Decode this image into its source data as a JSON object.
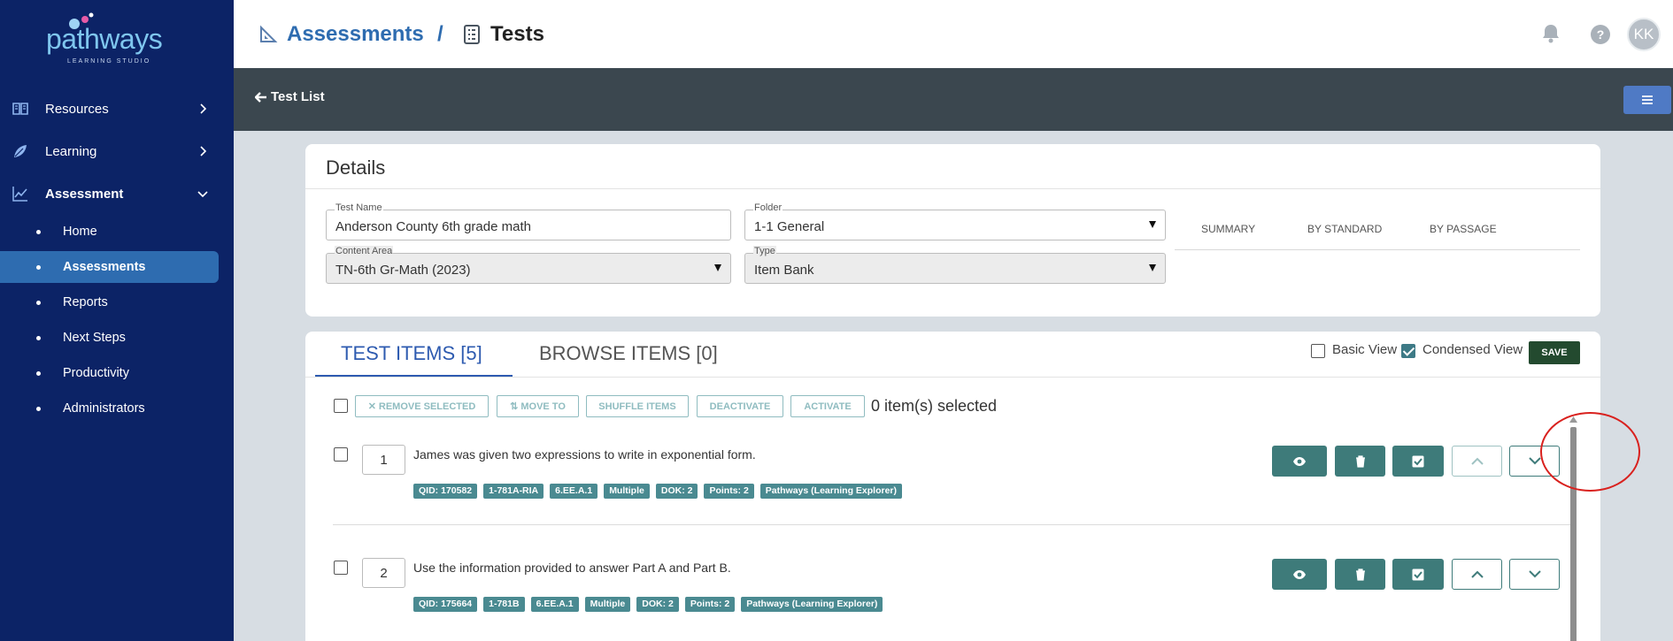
{
  "brand": {
    "name": "pathways",
    "tagline": "LEARNING STUDIO"
  },
  "colors": {
    "sidebar": "#0c2366",
    "active_nav": "#2e6cb0",
    "teal": "#3e7b7a",
    "save": "#234a2f",
    "highlight": "#d9211e"
  },
  "sidebar": {
    "items": [
      {
        "label": "Resources",
        "icon": "book-icon"
      },
      {
        "label": "Learning",
        "icon": "leaf-icon"
      },
      {
        "label": "Assessment",
        "icon": "chart-icon"
      }
    ],
    "subitems": [
      {
        "label": "Home"
      },
      {
        "label": "Assessments"
      },
      {
        "label": "Reports"
      },
      {
        "label": "Next Steps"
      },
      {
        "label": "Productivity"
      },
      {
        "label": "Administrators"
      }
    ]
  },
  "header": {
    "crumb1": "Assessments",
    "separator": "/",
    "crumb2": "Tests",
    "avatar": "KK",
    "help": "?"
  },
  "toolbar": {
    "back_label": "Test List"
  },
  "details": {
    "title": "Details",
    "test_name_label": "Test Name",
    "test_name": "Anderson County 6th grade math",
    "folder_label": "Folder",
    "folder": "1-1 General",
    "content_area_label": "Content Area",
    "content_area": "TN-6th Gr-Math (2023)",
    "type_label": "Type",
    "type": "Item Bank",
    "tabs": [
      "SUMMARY",
      "BY STANDARD",
      "BY PASSAGE"
    ]
  },
  "items_panel": {
    "tab_test_items": "TEST ITEMS [5]",
    "tab_browse_items": "BROWSE ITEMS [0]",
    "basic_view": "Basic View",
    "condensed_view": "Condensed View",
    "save": "SAVE",
    "actions": [
      "REMOVE SELECTED",
      "MOVE TO",
      "SHUFFLE ITEMS",
      "DEACTIVATE",
      "ACTIVATE"
    ],
    "selected_count": "0 item(s) selected",
    "rows": [
      {
        "num": "1",
        "text": "James was given two expressions to write in exponential form.",
        "tags": [
          "QID: 170582",
          "1-781A-RIA",
          "6.EE.A.1",
          "Multiple",
          "DOK: 2",
          "Points: 2",
          "Pathways (Learning Explorer)"
        ]
      },
      {
        "num": "2",
        "text": "Use the information provided to answer Part A and Part B.",
        "tags": [
          "QID: 175664",
          "1-781B",
          "6.EE.A.1",
          "Multiple",
          "DOK: 2",
          "Points: 2",
          "Pathways (Learning Explorer)"
        ]
      }
    ]
  }
}
